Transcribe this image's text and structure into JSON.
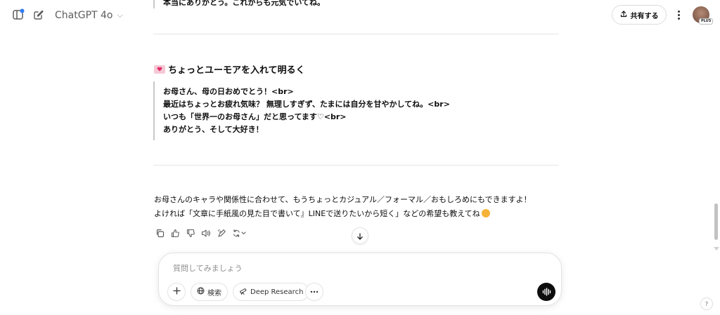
{
  "header": {
    "model_name": "ChatGPT 4o",
    "share_label": "共有する",
    "plan_badge": "PLUS"
  },
  "message": {
    "cut_off_line": "本当にありがとう。これからも元気でいてね。",
    "section_heading": "ちょっとユーモアを入れて明るく",
    "quote_lines": [
      "お母さん、母の日おめでとう！<br>",
      "最近はちょっとお疲れ気味？ 無理しすぎず、たまには自分を甘やかしてね。<br>",
      "いつも「世界一のお母さん」だと思ってます♡<br>",
      "ありがとう、そして大好き！"
    ],
    "closing_lines": [
      "お母さんのキャラや関係性に合わせて、もうちょっとカジュアル／フォーマル／おもしろめにもできますよ！",
      "よければ「文章に手紙風の見た目で書いて』LINEで送りたいから短く」などの希望も教えてね"
    ]
  },
  "actions": [
    "copy-icon",
    "thumbs-up-icon",
    "thumbs-down-icon",
    "read-aloud-icon",
    "edit-canvas-icon",
    "regenerate-icon"
  ],
  "composer": {
    "placeholder": "質問してみましょう",
    "search_label": "検索",
    "deep_research_label": "Deep Research"
  },
  "help_label": "?",
  "colors": {
    "accent_dot": "#2f7cf6",
    "voice_button": "#0d0d0d",
    "heart_badge": "#f6c8d6"
  }
}
